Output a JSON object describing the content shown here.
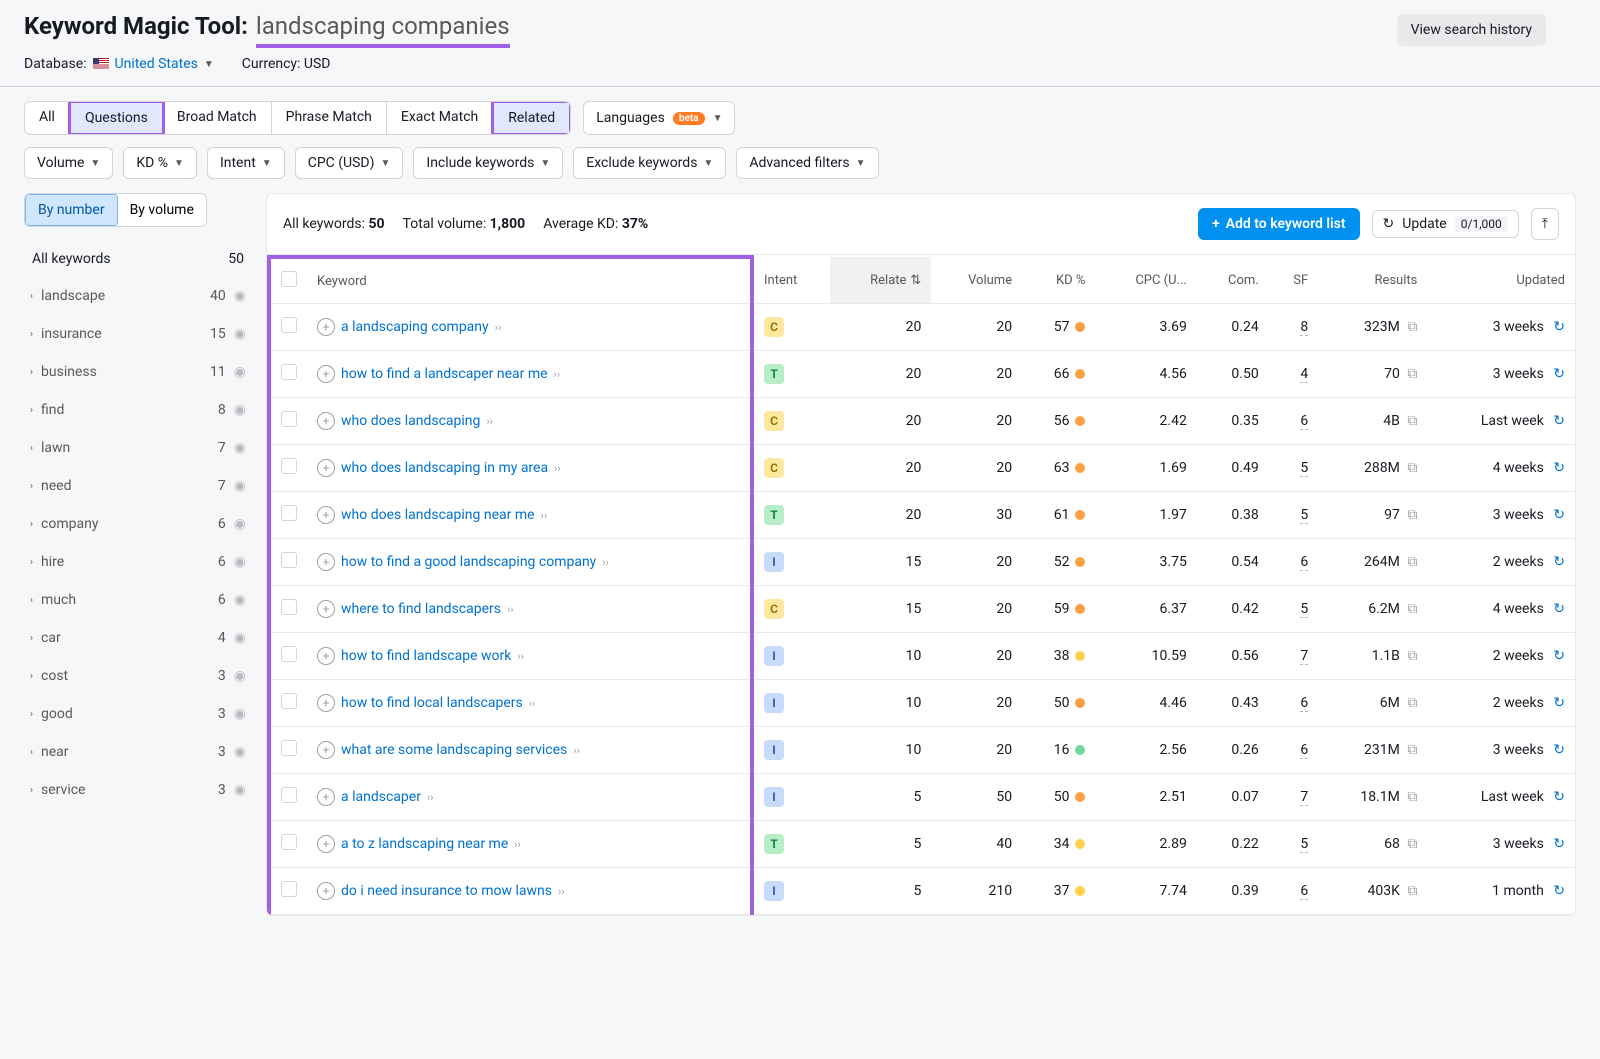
{
  "header": {
    "tool_title": "Keyword Magic Tool:",
    "search_term": "landscaping companies",
    "history_btn": "View search history",
    "database_label": "Database:",
    "database_value": "United States",
    "currency_label": "Currency: USD"
  },
  "tabs": {
    "all": "All",
    "questions": "Questions",
    "broad": "Broad Match",
    "phrase": "Phrase Match",
    "exact": "Exact Match",
    "related": "Related",
    "languages": "Languages",
    "beta": "beta"
  },
  "filters": {
    "volume": "Volume",
    "kd": "KD %",
    "intent": "Intent",
    "cpc": "CPC (USD)",
    "include": "Include keywords",
    "exclude": "Exclude keywords",
    "advanced": "Advanced filters"
  },
  "sidebar": {
    "by_number": "By number",
    "by_volume": "By volume",
    "all_kw_label": "All keywords",
    "all_kw_count": "50",
    "items": [
      {
        "label": "landscape",
        "count": "40"
      },
      {
        "label": "insurance",
        "count": "15"
      },
      {
        "label": "business",
        "count": "11"
      },
      {
        "label": "find",
        "count": "8"
      },
      {
        "label": "lawn",
        "count": "7"
      },
      {
        "label": "need",
        "count": "7"
      },
      {
        "label": "company",
        "count": "6"
      },
      {
        "label": "hire",
        "count": "6"
      },
      {
        "label": "much",
        "count": "6"
      },
      {
        "label": "car",
        "count": "4"
      },
      {
        "label": "cost",
        "count": "3"
      },
      {
        "label": "good",
        "count": "3"
      },
      {
        "label": "near",
        "count": "3"
      },
      {
        "label": "service",
        "count": "3"
      }
    ]
  },
  "stats": {
    "all_kw_label": "All keywords:",
    "all_kw_val": "50",
    "total_vol_label": "Total volume:",
    "total_vol_val": "1,800",
    "avg_kd_label": "Average KD:",
    "avg_kd_val": "37%"
  },
  "actions": {
    "add": "Add to keyword list",
    "update": "Update",
    "update_count": "0/1,000"
  },
  "columns": {
    "keyword": "Keyword",
    "intent": "Intent",
    "related": "Relate",
    "volume": "Volume",
    "kd": "KD %",
    "cpc": "CPC (U...",
    "com": "Com.",
    "sf": "SF",
    "results": "Results",
    "updated": "Updated"
  },
  "rows": [
    {
      "kw": "a landscaping company",
      "intent": "C",
      "rel": "20",
      "vol": "20",
      "kd": "57",
      "kdc": "o",
      "cpc": "3.69",
      "com": "0.24",
      "sf": "8",
      "res": "323M",
      "upd": "3 weeks"
    },
    {
      "kw": "how to find a landscaper near me",
      "intent": "T",
      "rel": "20",
      "vol": "20",
      "kd": "66",
      "kdc": "o",
      "cpc": "4.56",
      "com": "0.50",
      "sf": "4",
      "res": "70",
      "upd": "3 weeks"
    },
    {
      "kw": "who does landscaping",
      "intent": "C",
      "rel": "20",
      "vol": "20",
      "kd": "56",
      "kdc": "o",
      "cpc": "2.42",
      "com": "0.35",
      "sf": "6",
      "res": "4B",
      "upd": "Last week"
    },
    {
      "kw": "who does landscaping in my area",
      "intent": "C",
      "rel": "20",
      "vol": "20",
      "kd": "63",
      "kdc": "o",
      "cpc": "1.69",
      "com": "0.49",
      "sf": "5",
      "res": "288M",
      "upd": "4 weeks"
    },
    {
      "kw": "who does landscaping near me",
      "intent": "T",
      "rel": "20",
      "vol": "30",
      "kd": "61",
      "kdc": "o",
      "cpc": "1.97",
      "com": "0.38",
      "sf": "5",
      "res": "97",
      "upd": "3 weeks"
    },
    {
      "kw": "how to find a good landscaping company",
      "intent": "I",
      "rel": "15",
      "vol": "20",
      "kd": "52",
      "kdc": "o",
      "cpc": "3.75",
      "com": "0.54",
      "sf": "6",
      "res": "264M",
      "upd": "2 weeks"
    },
    {
      "kw": "where to find landscapers",
      "intent": "C",
      "rel": "15",
      "vol": "20",
      "kd": "59",
      "kdc": "o",
      "cpc": "6.37",
      "com": "0.42",
      "sf": "5",
      "res": "6.2M",
      "upd": "4 weeks"
    },
    {
      "kw": "how to find landscape work",
      "intent": "I",
      "rel": "10",
      "vol": "20",
      "kd": "38",
      "kdc": "y",
      "cpc": "10.59",
      "com": "0.56",
      "sf": "7",
      "res": "1.1B",
      "upd": "2 weeks"
    },
    {
      "kw": "how to find local landscapers",
      "intent": "I",
      "rel": "10",
      "vol": "20",
      "kd": "50",
      "kdc": "o",
      "cpc": "4.46",
      "com": "0.43",
      "sf": "6",
      "res": "6M",
      "upd": "2 weeks"
    },
    {
      "kw": "what are some landscaping services",
      "intent": "I",
      "rel": "10",
      "vol": "20",
      "kd": "16",
      "kdc": "g",
      "cpc": "2.56",
      "com": "0.26",
      "sf": "6",
      "res": "231M",
      "upd": "3 weeks"
    },
    {
      "kw": "a landscaper",
      "intent": "I",
      "rel": "5",
      "vol": "50",
      "kd": "50",
      "kdc": "o",
      "cpc": "2.51",
      "com": "0.07",
      "sf": "7",
      "res": "18.1M",
      "upd": "Last week"
    },
    {
      "kw": "a to z landscaping near me",
      "intent": "T",
      "rel": "5",
      "vol": "40",
      "kd": "34",
      "kdc": "y",
      "cpc": "2.89",
      "com": "0.22",
      "sf": "5",
      "res": "68",
      "upd": "3 weeks"
    },
    {
      "kw": "do i need insurance to mow lawns",
      "intent": "I",
      "rel": "5",
      "vol": "210",
      "kd": "37",
      "kdc": "y",
      "cpc": "7.74",
      "com": "0.39",
      "sf": "6",
      "res": "403K",
      "upd": "1 month"
    }
  ]
}
